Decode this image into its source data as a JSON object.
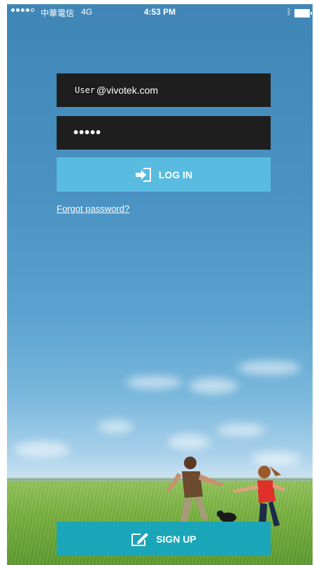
{
  "status_bar": {
    "carrier": "中華電信",
    "network": "4G",
    "time": "4:53 PM"
  },
  "login": {
    "email_user": "User",
    "email_domain": "@vivotek.com",
    "password_mask": "•••••",
    "login_label": "LOG IN",
    "forgot_label": "Forgot password?"
  },
  "signup": {
    "label": "SIGN UP"
  },
  "colors": {
    "login_button": "#5abbe1",
    "signup_button": "#1aa6b8",
    "field_bg": "#1e1e1e"
  },
  "icons": {
    "login": "login-arrow-icon",
    "signup": "edit-icon",
    "bluetooth": "bluetooth-icon",
    "battery": "battery-icon"
  }
}
